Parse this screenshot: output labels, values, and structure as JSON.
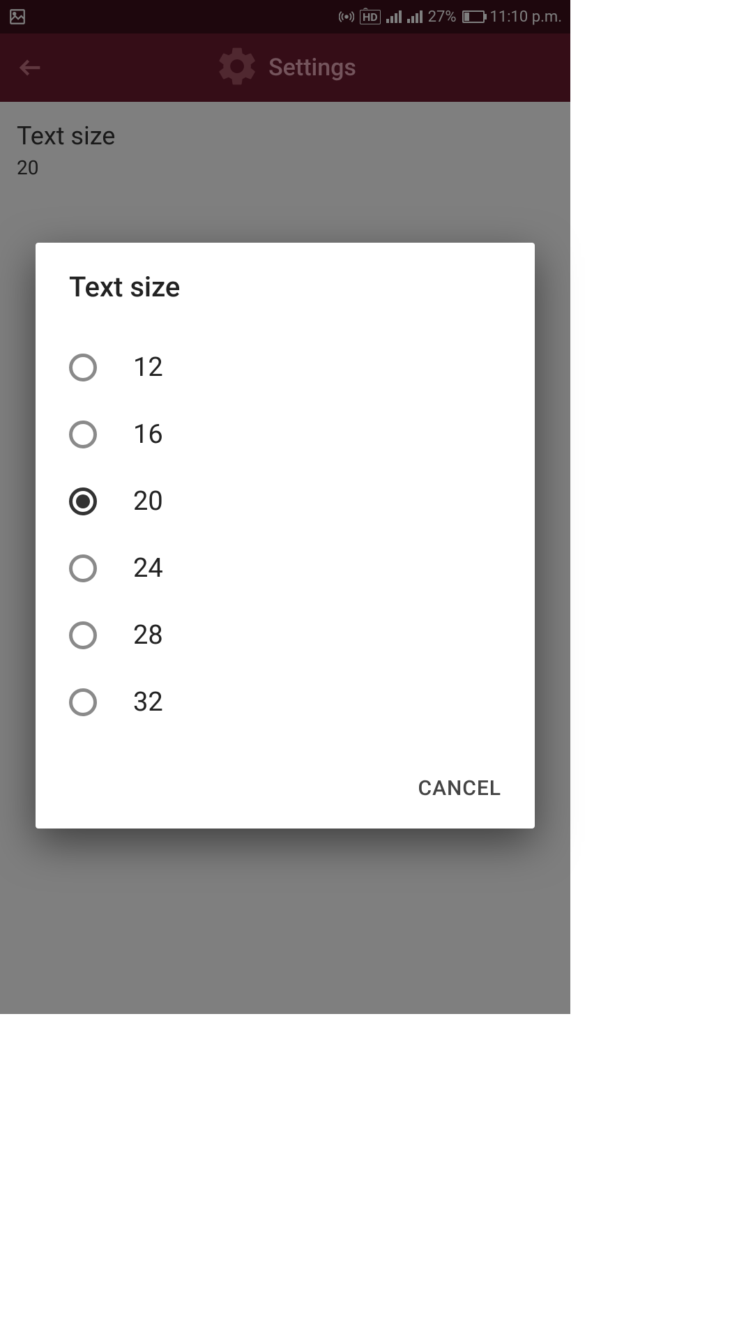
{
  "status_bar": {
    "battery_percent": "27%",
    "time": "11:10 p.m."
  },
  "app_bar": {
    "title": "Settings"
  },
  "content": {
    "setting_title": "Text size",
    "setting_value": "20"
  },
  "dialog": {
    "title": "Text size",
    "options": [
      "12",
      "16",
      "20",
      "24",
      "28",
      "32"
    ],
    "selected_index": 2,
    "cancel_label": "CANCEL"
  }
}
